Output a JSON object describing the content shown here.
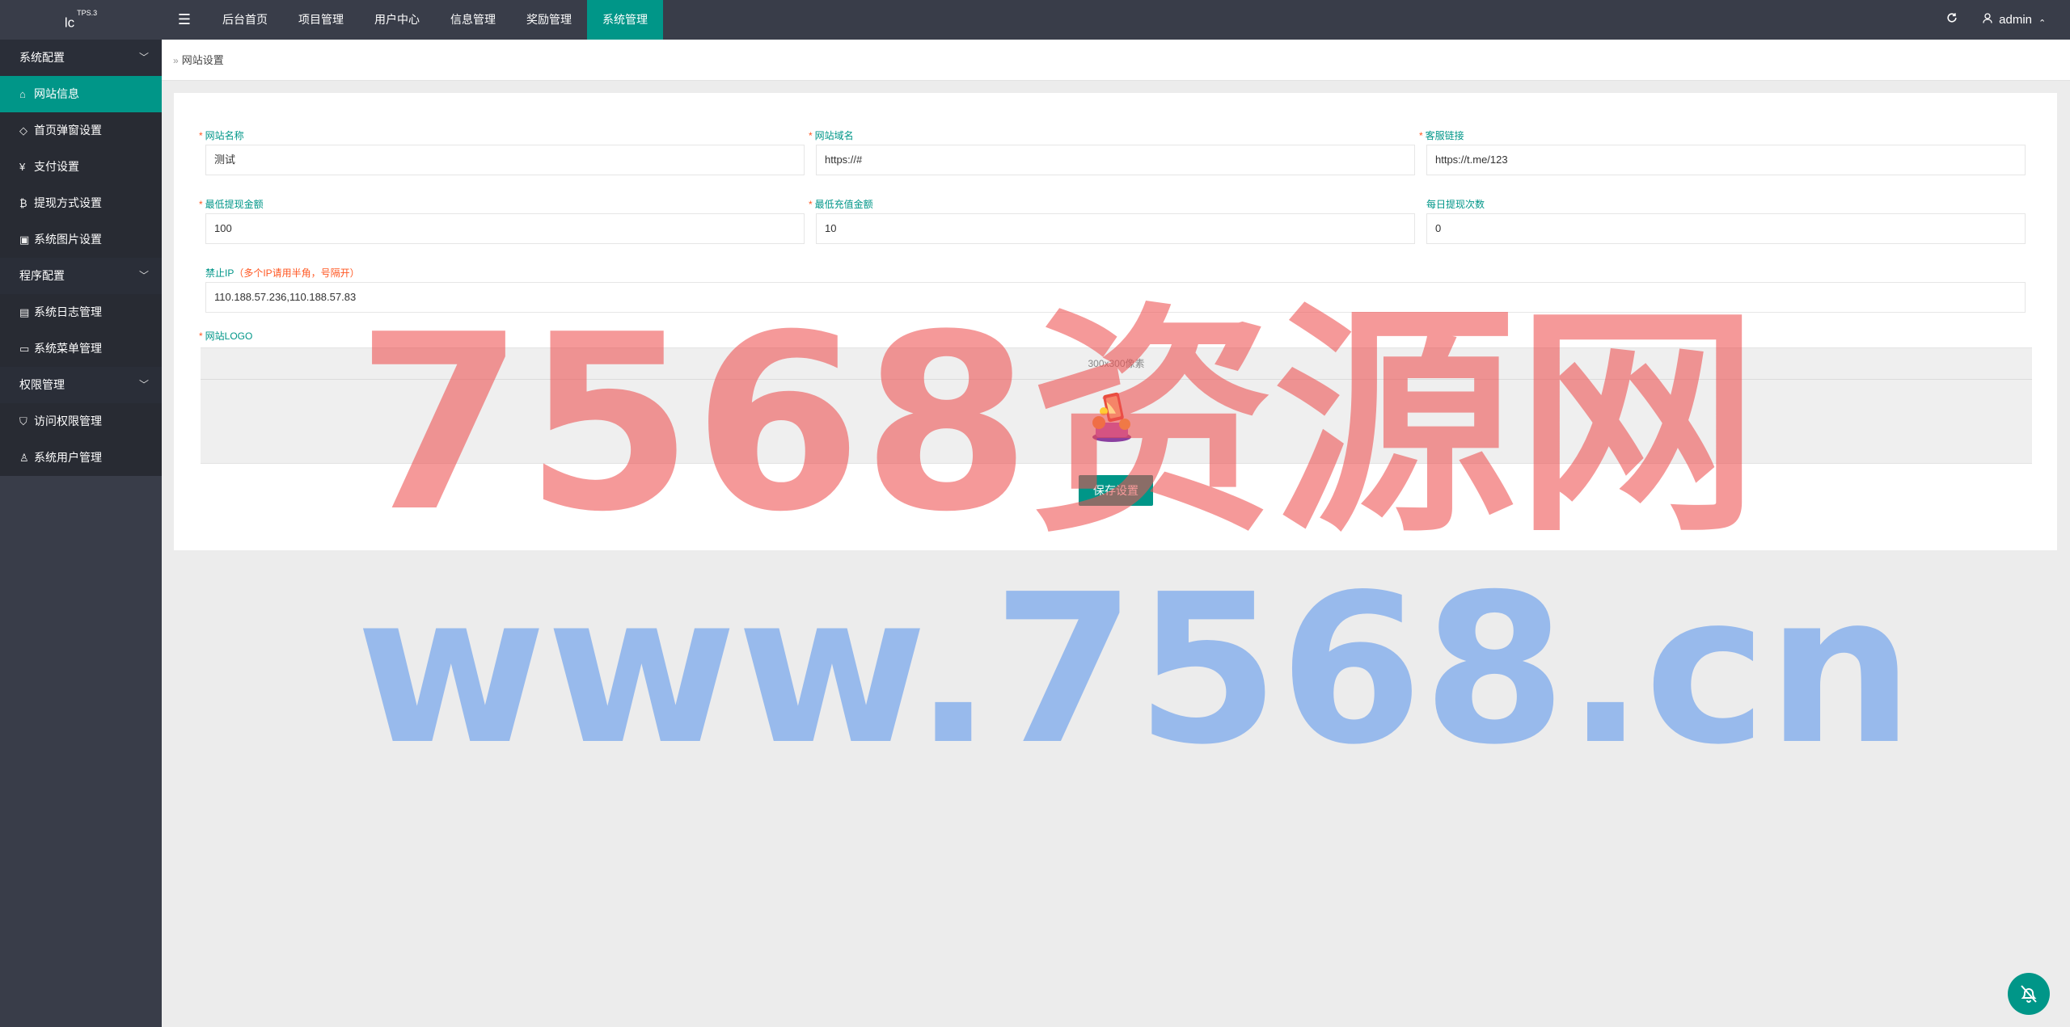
{
  "header": {
    "logo": "lc",
    "logo_sup": "TPS.3",
    "menu_toggle": "☰",
    "nav": [
      {
        "label": "后台首页",
        "active": false
      },
      {
        "label": "项目管理",
        "active": false
      },
      {
        "label": "用户中心",
        "active": false
      },
      {
        "label": "信息管理",
        "active": false
      },
      {
        "label": "奖励管理",
        "active": false
      },
      {
        "label": "系统管理",
        "active": true
      }
    ],
    "refresh_icon": "refresh-icon",
    "user": "admin"
  },
  "sidebar": {
    "groups": [
      {
        "title": "系统配置",
        "items": [
          {
            "label": "网站信息",
            "icon": "home-icon",
            "active": true
          },
          {
            "label": "首页弹窗设置",
            "icon": "tag-icon",
            "active": false
          },
          {
            "label": "支付设置",
            "icon": "yen-icon",
            "active": false
          },
          {
            "label": "提现方式设置",
            "icon": "bitcoin-icon",
            "active": false
          },
          {
            "label": "系统图片设置",
            "icon": "image-icon",
            "active": false
          }
        ]
      },
      {
        "title": "程序配置",
        "items": [
          {
            "label": "系统日志管理",
            "icon": "file-icon",
            "active": false
          },
          {
            "label": "系统菜单管理",
            "icon": "menu-icon",
            "active": false
          }
        ]
      },
      {
        "title": "权限管理",
        "items": [
          {
            "label": "访问权限管理",
            "icon": "shield-icon",
            "active": false
          },
          {
            "label": "系统用户管理",
            "icon": "user-icon",
            "active": false
          }
        ]
      }
    ]
  },
  "breadcrumb": {
    "arrow": "»",
    "label": "网站设置"
  },
  "form": {
    "site_name": {
      "label": "网站名称",
      "value": "测试",
      "required": true
    },
    "site_domain": {
      "label": "网站域名",
      "value": "https://#",
      "required": true
    },
    "service_link": {
      "label": "客服链接",
      "value": "https://t.me/123",
      "required": true
    },
    "min_withdraw": {
      "label": "最低提现金额",
      "value": "100",
      "required": true
    },
    "min_recharge": {
      "label": "最低充值金额",
      "value": "10",
      "required": true
    },
    "daily_withdraw_count": {
      "label": "每日提现次数",
      "value": "0",
      "required": false
    },
    "banned_ip": {
      "label": "禁止IP",
      "hint": "（多个IP请用半角，号隔开）",
      "value": "110.188.57.236,110.188.57.83"
    },
    "logo": {
      "label": "网站LOGO",
      "size_hint": "300x300像素",
      "required": true
    },
    "required_mark": "*",
    "save_label": "保存设置"
  },
  "watermark": {
    "line1": "7568资源网",
    "line2": "www.7568.cn"
  },
  "colors": {
    "accent": "#009688",
    "dark": "#393d49",
    "required": "#ff5722"
  }
}
